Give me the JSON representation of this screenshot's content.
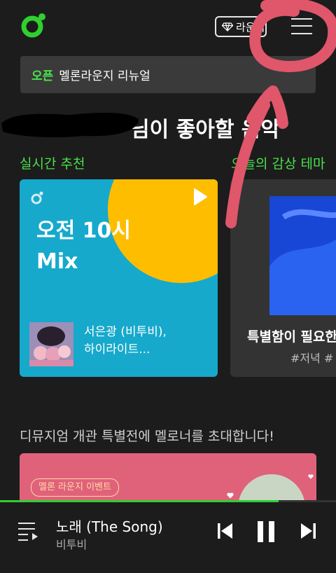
{
  "header": {
    "lounge_label": "라운지",
    "notice_tag": "오픈",
    "notice_text": "멜론라운지 리뉴얼"
  },
  "recommend": {
    "section_title": "님이 좋아할 음악",
    "realtime_label": "실시간 추천",
    "theme_label": "오늘의 감상 테마",
    "mix_card": {
      "title_line1": "오전 10시",
      "title_line2": "Mix",
      "artist_line1": "서은광 (비투비),",
      "artist_line2": "하이라이트..."
    },
    "theme_card": {
      "title": "특별함이 필요한",
      "hashtag": "#저녁 #"
    }
  },
  "event": {
    "title": "디뮤지엄 개관 특별전에 멜로너를 초대합니다!",
    "badge": "멜론 라운지 이벤트"
  },
  "now_playing": {
    "song": "노래 (The Song)",
    "artist": "비투비",
    "progress": 0.83
  },
  "colors": {
    "accent": "#2fd02f",
    "background": "#1c1c1c",
    "mix_card_blue": "#16a9cc",
    "mix_card_yellow": "#ffbd00",
    "banner_pink": "#e0627a",
    "annotation": "#e0566a"
  }
}
